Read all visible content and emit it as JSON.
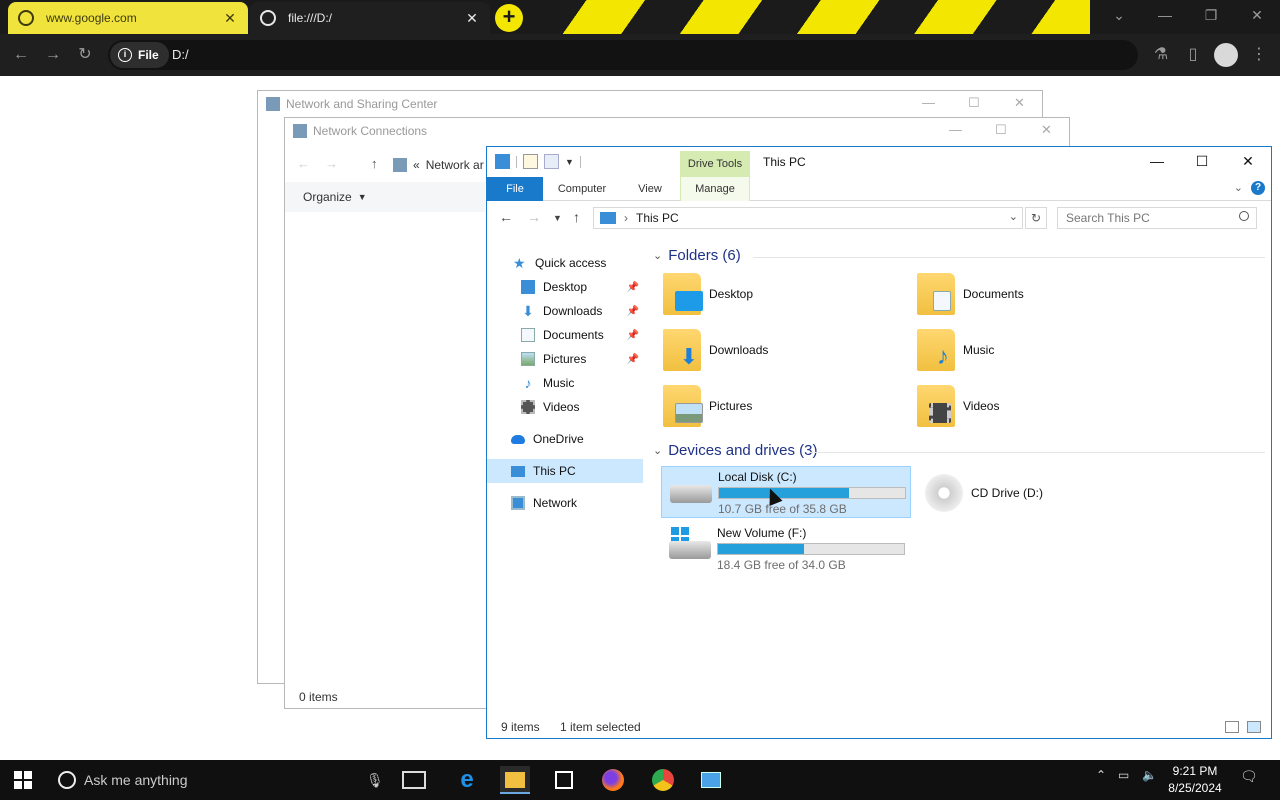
{
  "browser": {
    "tabs": [
      {
        "title": "www.google.com",
        "active": false
      },
      {
        "title": "file:///D:/",
        "active": true
      }
    ],
    "address_chip": "File",
    "url": "D:/"
  },
  "bg_windows": {
    "network_sharing_title": "Network and Sharing Center",
    "network_connections_title": "Network Connections",
    "breadcrumb": "Network ar",
    "organize_label": "Organize",
    "items_count": "0 items"
  },
  "explorer": {
    "contextual_tab_group": "Drive Tools",
    "window_title": "This PC",
    "ribbon_tabs": [
      "File",
      "Computer",
      "View",
      "Manage"
    ],
    "address_path": "This PC",
    "search_placeholder": "Search This PC",
    "nav_pane": [
      {
        "label": "Quick access",
        "icon": "star-icon",
        "pinned": false
      },
      {
        "label": "Desktop",
        "icon": "desktop-icon",
        "pinned": true
      },
      {
        "label": "Downloads",
        "icon": "download-arrow-icon",
        "pinned": true
      },
      {
        "label": "Documents",
        "icon": "document-icon",
        "pinned": true
      },
      {
        "label": "Pictures",
        "icon": "picture-icon",
        "pinned": true
      },
      {
        "label": "Music",
        "icon": "music-note-icon",
        "pinned": false
      },
      {
        "label": "Videos",
        "icon": "film-icon",
        "pinned": false
      },
      {
        "label": "OneDrive",
        "icon": "cloud-icon",
        "pinned": false
      },
      {
        "label": "This PC",
        "icon": "monitor-icon",
        "pinned": false,
        "selected": true
      },
      {
        "label": "Network",
        "icon": "network-icon",
        "pinned": false
      }
    ],
    "folders_header": "Folders (6)",
    "folders": [
      {
        "label": "Desktop",
        "overlay": "desktop-icon"
      },
      {
        "label": "Documents",
        "overlay": "document-icon"
      },
      {
        "label": "Downloads",
        "overlay": "download-arrow-icon"
      },
      {
        "label": "Music",
        "overlay": "music-note-icon"
      },
      {
        "label": "Pictures",
        "overlay": "picture-icon"
      },
      {
        "label": "Videos",
        "overlay": "film-icon"
      }
    ],
    "drives_header": "Devices and drives (3)",
    "drives": [
      {
        "name": "Local Disk (C:)",
        "free_text": "10.7 GB free of 35.8 GB",
        "used_fraction": 0.7,
        "selected": true
      },
      {
        "name": "CD Drive (D:)",
        "free_text": "",
        "used_fraction": null,
        "selected": false
      },
      {
        "name": "New Volume (F:)",
        "free_text": "18.4 GB free of 34.0 GB",
        "used_fraction": 0.46,
        "selected": false
      }
    ],
    "status_items": "9 items",
    "status_selected": "1 item selected"
  },
  "taskbar": {
    "search_placeholder": "Ask me anything",
    "time": "9:21 PM",
    "date": "8/25/2024"
  },
  "colors": {
    "accent_blue": "#1979ca",
    "selection": "#cce8ff",
    "drive_bar": "#26a0da",
    "drive_tools": "#d5ebb2",
    "tab_yellow": "#f0e43c"
  }
}
